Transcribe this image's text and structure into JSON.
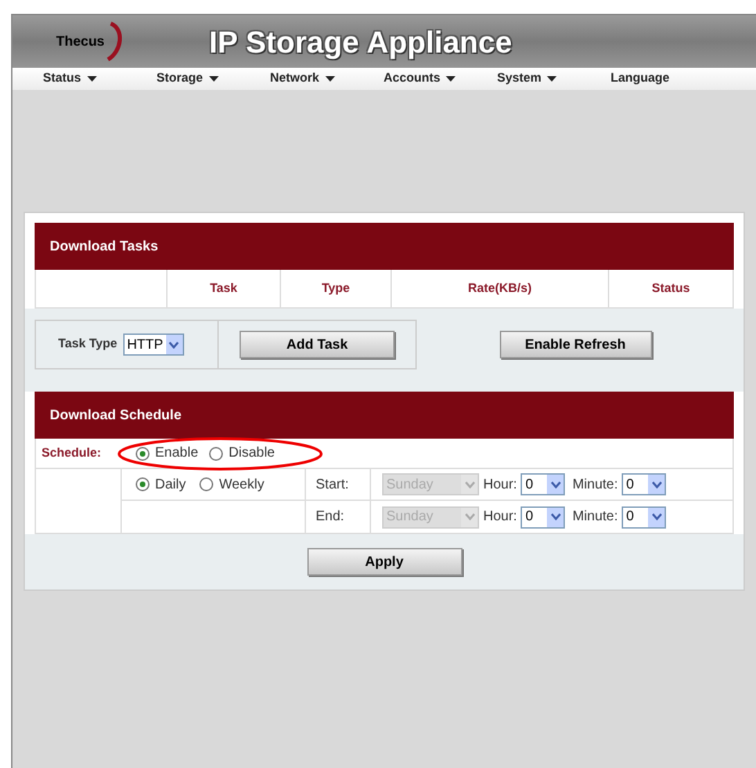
{
  "header": {
    "logo": "Thecus",
    "title": "IP Storage Appliance"
  },
  "nav": [
    {
      "label": "Status",
      "caret": true
    },
    {
      "label": "Storage",
      "caret": true
    },
    {
      "label": "Network",
      "caret": true
    },
    {
      "label": "Accounts",
      "caret": true
    },
    {
      "label": "System",
      "caret": true
    },
    {
      "label": "Language",
      "caret": false
    }
  ],
  "download_tasks": {
    "title": "Download Tasks",
    "columns": [
      "Task",
      "Type",
      "Rate(KB/s)",
      "Status"
    ],
    "task_type_label": "Task Type",
    "task_type": "HTTP",
    "buttons": [
      "Add Task",
      "Enable Refresh"
    ]
  },
  "download_schedule": {
    "title": "Download Schedule",
    "scheduler_label": "Schedule:",
    "scheduler_options": [
      {
        "label": "Enable",
        "selected": true
      },
      {
        "label": "Disable",
        "selected": false
      }
    ],
    "frequency_options": [
      {
        "label": "Daily",
        "selected": true
      },
      {
        "label": "Weekly",
        "selected": false
      }
    ],
    "rows": [
      {
        "label": "Start:",
        "day": "Sunday",
        "day_disabled": true,
        "hour_label": "Hour:",
        "hour": "0",
        "minute_label": "Minute:",
        "minute": "0"
      },
      {
        "label": "End:",
        "day": "Sunday",
        "day_disabled": true,
        "hour_label": "Hour:",
        "hour": "0",
        "minute_label": "Minute:",
        "minute": "0"
      }
    ],
    "apply": "Apply",
    "highlight_annotation": true
  }
}
